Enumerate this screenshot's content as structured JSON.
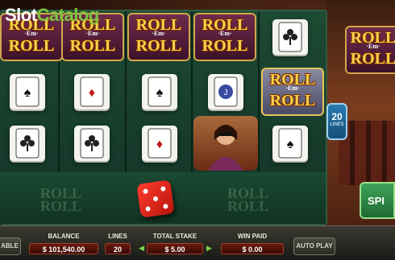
{
  "brand": {
    "part1": "Slot",
    "part2": "Catalog"
  },
  "symbols": {
    "roll_top": "ROLL",
    "roll_em": "·Em·",
    "roll_bottom": "ROLL"
  },
  "lines_badge": {
    "value": "20",
    "label": "LINES"
  },
  "spin": {
    "label": "SPI"
  },
  "bottom_bar": {
    "left_button": "ABLE",
    "balance_label": "BALANCE",
    "balance_value": "$ 101,540.00",
    "lines_label": "LINES",
    "lines_value": "20",
    "stake_label": "TOTAL STAKE",
    "stake_value": "$ 5.00",
    "win_label": "WIN PAID",
    "win_value": "$ 0.00",
    "autoplay": "AUTO PLAY"
  },
  "icons": [
    "dice-icon",
    "club-card-icon",
    "spade-card-icon",
    "diamond-card-icon",
    "jack-card-icon"
  ],
  "colors": {
    "felt": "#1d4a33",
    "gold": "#f6d34a",
    "spin": "#3fa45a",
    "dice": "#ff3b2e"
  }
}
